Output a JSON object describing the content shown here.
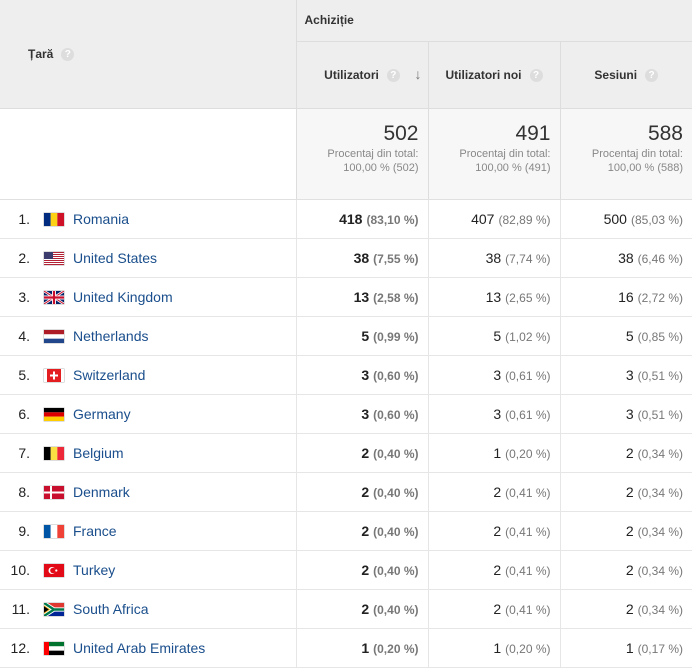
{
  "header": {
    "group_label": "Achiziție",
    "country_label": "Țară",
    "help_glyph": "?",
    "sort_glyph": "↓",
    "columns": [
      "Utilizatori",
      "Utilizatori noi",
      "Sesiuni"
    ]
  },
  "totals": [
    {
      "value": "502",
      "line1": "Procentaj din total:",
      "line2": "100,00 % (502)"
    },
    {
      "value": "491",
      "line1": "Procentaj din total:",
      "line2": "100,00 % (491)"
    },
    {
      "value": "588",
      "line1": "Procentaj din total:",
      "line2": "100,00 % (588)"
    }
  ],
  "rows": [
    {
      "idx": "1.",
      "country": "Romania",
      "flag": "ro",
      "users": "418",
      "users_pct": "(83,10 %)",
      "new": "407",
      "new_pct": "(82,89 %)",
      "sess": "500",
      "sess_pct": "(85,03 %)"
    },
    {
      "idx": "2.",
      "country": "United States",
      "flag": "us",
      "users": "38",
      "users_pct": "(7,55 %)",
      "new": "38",
      "new_pct": "(7,74 %)",
      "sess": "38",
      "sess_pct": "(6,46 %)"
    },
    {
      "idx": "3.",
      "country": "United Kingdom",
      "flag": "gb",
      "users": "13",
      "users_pct": "(2,58 %)",
      "new": "13",
      "new_pct": "(2,65 %)",
      "sess": "16",
      "sess_pct": "(2,72 %)"
    },
    {
      "idx": "4.",
      "country": "Netherlands",
      "flag": "nl",
      "users": "5",
      "users_pct": "(0,99 %)",
      "new": "5",
      "new_pct": "(1,02 %)",
      "sess": "5",
      "sess_pct": "(0,85 %)"
    },
    {
      "idx": "5.",
      "country": "Switzerland",
      "flag": "ch",
      "users": "3",
      "users_pct": "(0,60 %)",
      "new": "3",
      "new_pct": "(0,61 %)",
      "sess": "3",
      "sess_pct": "(0,51 %)"
    },
    {
      "idx": "6.",
      "country": "Germany",
      "flag": "de",
      "users": "3",
      "users_pct": "(0,60 %)",
      "new": "3",
      "new_pct": "(0,61 %)",
      "sess": "3",
      "sess_pct": "(0,51 %)"
    },
    {
      "idx": "7.",
      "country": "Belgium",
      "flag": "be",
      "users": "2",
      "users_pct": "(0,40 %)",
      "new": "1",
      "new_pct": "(0,20 %)",
      "sess": "2",
      "sess_pct": "(0,34 %)"
    },
    {
      "idx": "8.",
      "country": "Denmark",
      "flag": "dk",
      "users": "2",
      "users_pct": "(0,40 %)",
      "new": "2",
      "new_pct": "(0,41 %)",
      "sess": "2",
      "sess_pct": "(0,34 %)"
    },
    {
      "idx": "9.",
      "country": "France",
      "flag": "fr",
      "users": "2",
      "users_pct": "(0,40 %)",
      "new": "2",
      "new_pct": "(0,41 %)",
      "sess": "2",
      "sess_pct": "(0,34 %)"
    },
    {
      "idx": "10.",
      "country": "Turkey",
      "flag": "tr",
      "users": "2",
      "users_pct": "(0,40 %)",
      "new": "2",
      "new_pct": "(0,41 %)",
      "sess": "2",
      "sess_pct": "(0,34 %)"
    },
    {
      "idx": "11.",
      "country": "South Africa",
      "flag": "za",
      "users": "2",
      "users_pct": "(0,40 %)",
      "new": "2",
      "new_pct": "(0,41 %)",
      "sess": "2",
      "sess_pct": "(0,34 %)"
    },
    {
      "idx": "12.",
      "country": "United Arab Emirates",
      "flag": "ae",
      "users": "1",
      "users_pct": "(0,20 %)",
      "new": "1",
      "new_pct": "(0,20 %)",
      "sess": "1",
      "sess_pct": "(0,17 %)"
    }
  ]
}
